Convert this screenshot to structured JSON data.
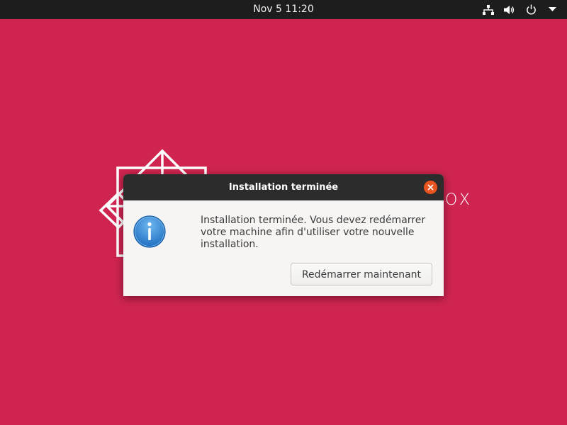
{
  "topbar": {
    "clock": "Nov 5  11:20",
    "tray_icons": [
      "network-icon",
      "volume-icon",
      "power-icon",
      "chevron-down-icon"
    ]
  },
  "wallpaper": {
    "color": "#cf2450",
    "logo_partial_text": "OX"
  },
  "dialog": {
    "title": "Installation terminée",
    "message": "Installation terminée. Vous devez redémarrer votre machine afin d'utiliser votre nouvelle installation.",
    "icon": "info-icon",
    "restart_button_label": "Redémarrer maintenant",
    "close_button_color": "#e95420"
  }
}
